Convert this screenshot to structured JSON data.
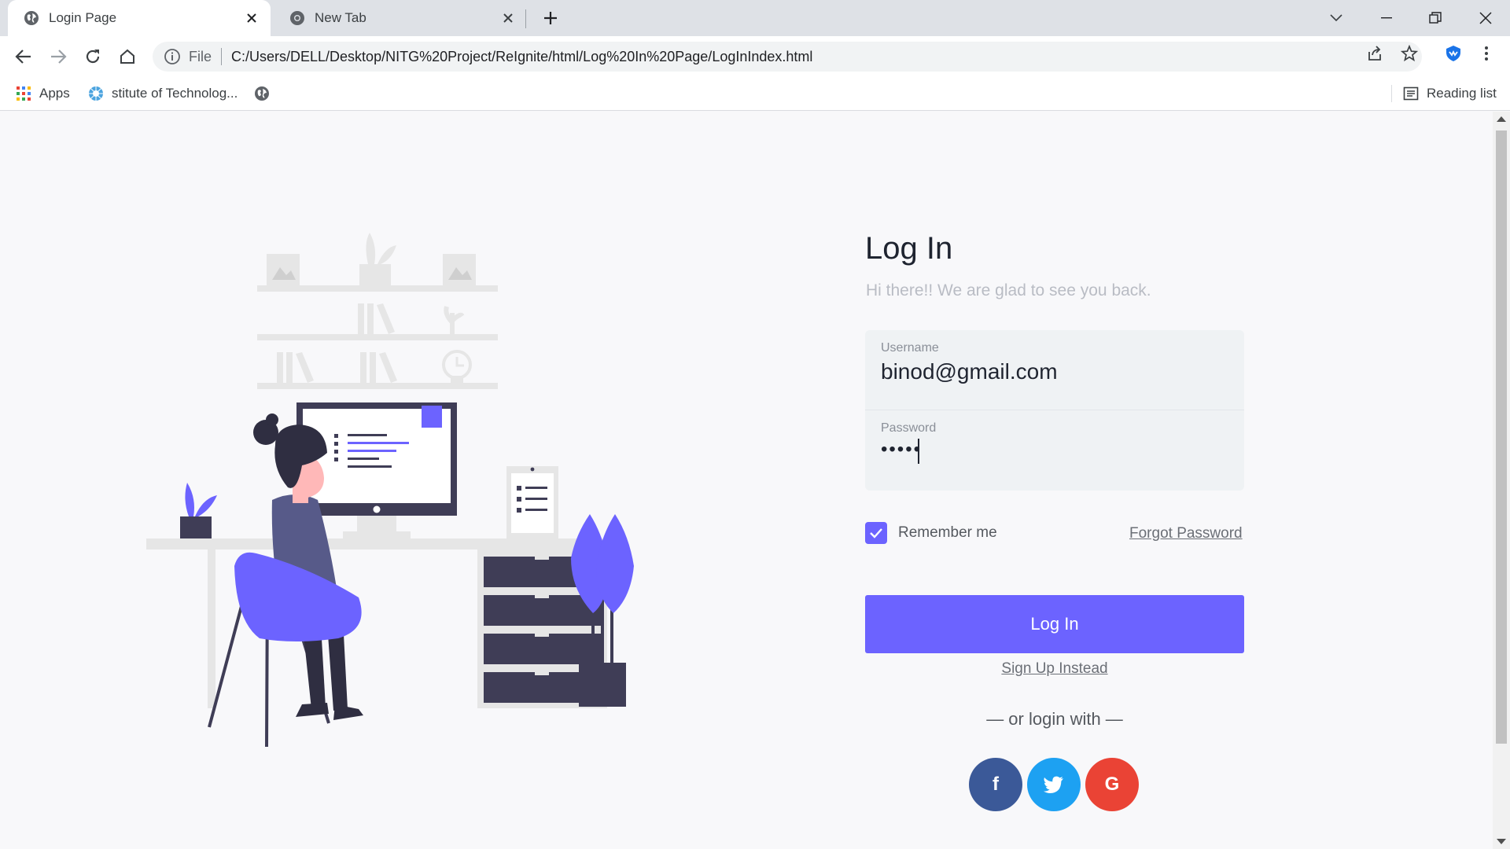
{
  "browser": {
    "tabs": [
      {
        "title": "Login Page",
        "active": true
      },
      {
        "title": "New Tab",
        "active": false
      }
    ],
    "omnibox": {
      "scheme_label": "File",
      "url": "C:/Users/DELL/Desktop/NITG%20Project/ReIgnite/html/Log%20In%20Page/LogInIndex.html"
    },
    "bookmarks": [
      {
        "label": "Apps",
        "icon": "apps-grid-icon"
      },
      {
        "label": "stitute of Technolog...",
        "icon": "institute-favicon-icon"
      },
      {
        "label": "",
        "icon": "globe-icon"
      }
    ],
    "reading_list_label": "Reading list"
  },
  "login": {
    "title": "Log In",
    "subtitle": "Hi there!! We are glad to see you back.",
    "username_label": "Username",
    "username_value": "binod@gmail.com",
    "password_label": "Password",
    "password_value": "•••••",
    "remember_label": "Remember me",
    "remember_checked": true,
    "forgot_label": "Forgot Password",
    "login_button": "Log In",
    "signup_label": "Sign Up Instead",
    "or_login_with": "— or login with —",
    "social": [
      {
        "name": "facebook",
        "glyph": "f",
        "color": "#3b5998"
      },
      {
        "name": "twitter",
        "glyph": "",
        "color": "#1da1f2"
      },
      {
        "name": "google",
        "glyph": "G",
        "color": "#ea4335"
      }
    ]
  },
  "colors": {
    "accent": "#6c63ff",
    "dark": "#3f3d56",
    "light_gray": "#e6e6e6"
  }
}
